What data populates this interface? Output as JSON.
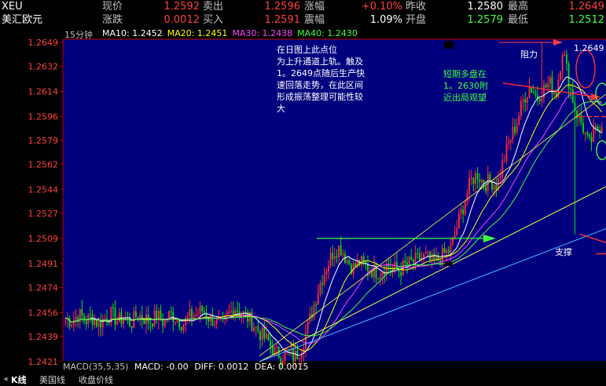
{
  "quote": {
    "symbol": "XEU",
    "name": "美汇欧元",
    "rows": [
      [
        {
          "l": "现价",
          "v": "1.2592",
          "c": "#ff4040"
        },
        {
          "l": "卖出",
          "v": "1.2596",
          "c": "#ff4040"
        },
        {
          "l": "涨幅",
          "v": "+0.10%",
          "c": "#ff4040"
        },
        {
          "l": "昨收",
          "v": "1.2580",
          "c": "#ffffff"
        },
        {
          "l": "最高",
          "v": "1.2649",
          "c": "#ff4040"
        }
      ],
      [
        {
          "l": "涨跌",
          "v": "0.0012",
          "c": "#ff4040"
        },
        {
          "l": "买入",
          "v": "1.2591",
          "c": "#ff4040"
        },
        {
          "l": "震幅",
          "v": "1.09%",
          "c": "#ffffff"
        },
        {
          "l": "开盘",
          "v": "1.2579",
          "c": "#40ff40"
        },
        {
          "l": "最低",
          "v": "1.2512",
          "c": "#40ff40"
        }
      ]
    ]
  },
  "period": "15分钟",
  "ma": [
    {
      "label": "MA10: 1.2452",
      "color": "#ffffff"
    },
    {
      "label": "MA20: 1.2451",
      "color": "#ffff00"
    },
    {
      "label": "MA30: 1.2438",
      "color": "#ff40ff"
    },
    {
      "label": "MA40: 1.2430",
      "color": "#40ff40"
    }
  ],
  "chart_data": {
    "type": "candlestick",
    "y_ticks": [
      "1.2649",
      "1.2632",
      "1.2614",
      "1.2596",
      "1.2579",
      "1.2562",
      "1.2544",
      "1.2527",
      "1.2509",
      "1.2491",
      "1.2474",
      "1.2456",
      "1.2439",
      "1.2421"
    ],
    "ylim": [
      1.2421,
      1.2649
    ],
    "grid": false,
    "high_label": "1.2649",
    "price_path": [
      1.2452,
      1.245,
      1.2455,
      1.245,
      1.2453,
      1.2448,
      1.2452,
      1.2455,
      1.245,
      1.2453,
      1.2448,
      1.2455,
      1.2452,
      1.245,
      1.2454,
      1.2449,
      1.2455,
      1.2452,
      1.2448,
      1.2453,
      1.2455,
      1.2458,
      1.2452,
      1.245,
      1.2447,
      1.2455,
      1.246,
      1.2455,
      1.2452,
      1.2446,
      1.244,
      1.2435,
      1.2428,
      1.2425,
      1.2428,
      1.2424,
      1.243,
      1.2445,
      1.2462,
      1.2478,
      1.249,
      1.25,
      1.2503,
      1.2494,
      1.2488,
      1.2492,
      1.2489,
      1.2486,
      1.2485,
      1.249,
      1.2488,
      1.2486,
      1.249,
      1.2492,
      1.2494,
      1.2496,
      1.2492,
      1.2494,
      1.2498,
      1.2502,
      1.252,
      1.2535,
      1.255,
      1.2555,
      1.2548,
      1.255,
      1.2547,
      1.2565,
      1.258,
      1.2592,
      1.2608,
      1.2618,
      1.261,
      1.2615,
      1.262,
      1.2612,
      1.2645,
      1.262,
      1.26,
      1.259,
      1.2575,
      1.2585,
      1.2592
    ]
  },
  "annotations": {
    "note_main": "在日图上此点位为上升通道上轨。触及1。2649点随后生产快速回落走势，在此区间形成振荡整理可能性较大",
    "note_green": "短期多盘在1。2630附近出局观望",
    "resistance": "阻力",
    "support": "支撑",
    "note_main_lines": [
      "在日图上此点位",
      "为上升通道上轨。触及",
      "1。2649点随后生产快",
      "速回落走势，在此区间",
      "形成振荡整理可能性较",
      "大"
    ],
    "note_green_lines": [
      "短期多盘在",
      "1。2630附",
      "近出局观望"
    ]
  },
  "macd": {
    "label": "MACD(35,5,35)",
    "macd": "MACD: -0.00",
    "diff": "DIFF: 0.0012",
    "dea": "DEA: 0.0015"
  },
  "tabs": [
    "K线",
    "美国线",
    "收盘价线"
  ]
}
